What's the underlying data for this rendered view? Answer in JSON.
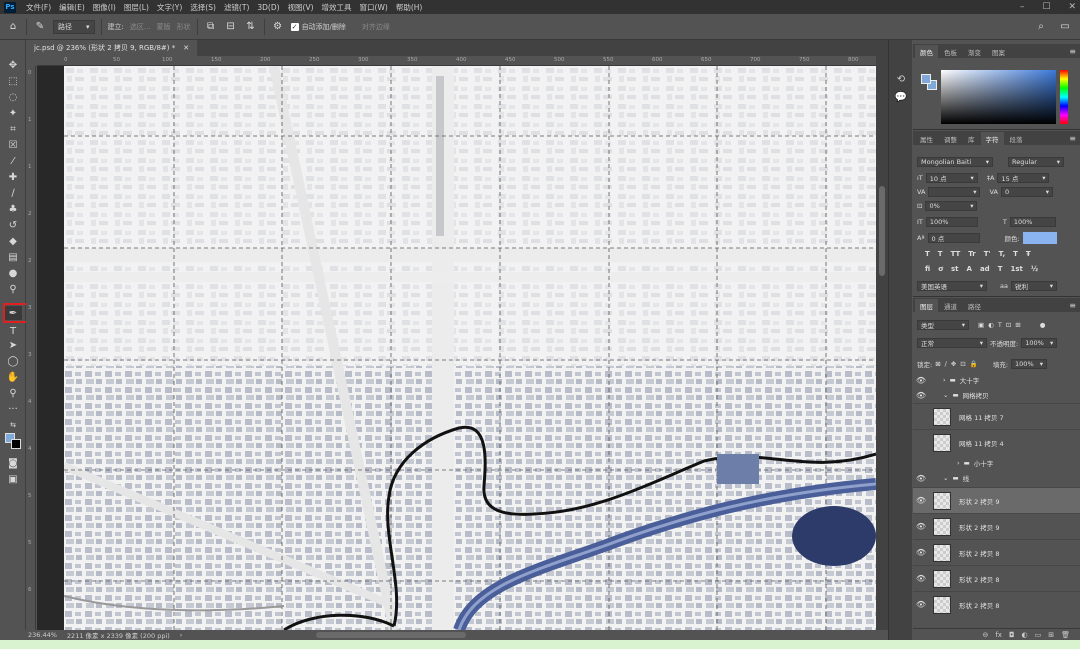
{
  "menubar": {
    "logo": "Ps",
    "items": [
      "文件(F)",
      "编辑(E)",
      "图像(I)",
      "图层(L)",
      "文字(Y)",
      "选择(S)",
      "滤镜(T)",
      "3D(D)",
      "视图(V)",
      "增效工具",
      "窗口(W)",
      "帮助(H)"
    ]
  },
  "options": {
    "mode": "路径",
    "make_label": "建立:",
    "selection": "选区...",
    "mask": "蒙版",
    "shape": "形状",
    "auto_add": "自动添加/删除",
    "align_edges": "对齐边缘"
  },
  "document": {
    "tab_title": "jc.psd @ 236% (形状 2 拷贝 9, RGB/8#) *",
    "ruler_top": [
      "0",
      "50",
      "100",
      "150",
      "200",
      "250",
      "300",
      "350",
      "400",
      "450",
      "500",
      "550",
      "600",
      "650",
      "700",
      "750",
      "800"
    ],
    "ruler_left": [
      "0",
      "1",
      "1",
      "2",
      "2",
      "3",
      "3",
      "4",
      "4",
      "5",
      "5",
      "6"
    ],
    "status_zoom": "236.44%",
    "status_info": "2211 像素 x 2339 像素 (200 ppi)"
  },
  "color_panel": {
    "tabs": [
      "颜色",
      "色板",
      "渐变",
      "图案"
    ],
    "fg": "#7fa9d9"
  },
  "char_panel": {
    "tabs": [
      "属性",
      "调整",
      "库",
      "字符",
      "段落"
    ],
    "font": "Mongolian Baiti",
    "style": "Regular",
    "size": "10 点",
    "leading": "15 点",
    "kerning": "",
    "tracking": "0",
    "scale_pct": "0%",
    "vscale": "100%",
    "hscale": "100%",
    "baseline": "0 点",
    "color_label": "颜色:",
    "color": "#8ab4f0",
    "glyphs": [
      "T",
      "T",
      "TT",
      "Tr",
      "T'",
      "T,",
      "T",
      "Ŧ"
    ],
    "glyphs2": [
      "fi",
      "ơ",
      "st",
      "A",
      "ad",
      "T",
      "1st",
      "½"
    ],
    "language": "美国英语",
    "aa": "锐利"
  },
  "layers_panel": {
    "tabs": [
      "图层",
      "通道",
      "路径"
    ],
    "filter": "类型",
    "blend": "正常",
    "opacity_label": "不透明度:",
    "opacity": "100%",
    "lock_label": "锁定:",
    "fill_label": "填充:",
    "fill": "100%",
    "groups": [
      {
        "name": "大十字"
      },
      {
        "name": "网格拷贝"
      },
      {
        "name": "小十字"
      },
      {
        "name": "线"
      }
    ],
    "layers": [
      {
        "name": "网格 11 拷贝 7"
      },
      {
        "name": "网格 11 拷贝 4"
      },
      {
        "name": "形状 2 拷贝 9"
      },
      {
        "name": "形状 2 拷贝 9"
      },
      {
        "name": "形状 2 拷贝 8"
      },
      {
        "name": "形状 2 拷贝 8"
      },
      {
        "name": "形状 2 拷贝 8"
      }
    ],
    "footer": [
      "⊖",
      "fx",
      "◘",
      "◐",
      "▭",
      "⊞",
      "🗑"
    ]
  }
}
